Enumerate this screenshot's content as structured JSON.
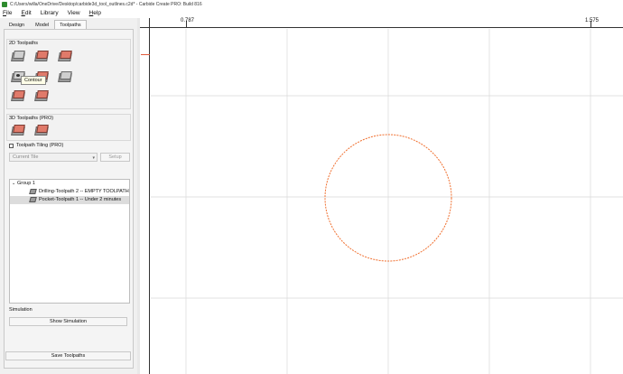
{
  "window": {
    "title": "C:/Users/willa/OneDrive/Desktop/carbide3d_tool_outlines.c2d* - Carbide Create PRO: Build 816"
  },
  "menu": [
    {
      "label": "File",
      "key": "F"
    },
    {
      "label": "Edit",
      "key": "E"
    },
    {
      "label": "Library",
      "key": ""
    },
    {
      "label": "View",
      "key": ""
    },
    {
      "label": "Help",
      "key": "H"
    }
  ],
  "tabs": [
    "Design",
    "Model",
    "Toolpaths"
  ],
  "toolpaths2d": {
    "title": "2D Toolpaths",
    "tooltip": "Contour"
  },
  "toolpaths3d": {
    "title": "3D Toolpaths (PRO)"
  },
  "tiling": {
    "label": "Toolpath Tiling (PRO)",
    "current_tile_placeholder": "Current Tile",
    "setup_label": "Setup"
  },
  "tree": {
    "group_label": "Group 1",
    "items": [
      {
        "label": "Drilling-Toolpath 2 -- EMPTY TOOLPATH",
        "selected": false
      },
      {
        "label": "Pocket-Toolpath 1 -- Under 2 minutes",
        "selected": true
      }
    ]
  },
  "simulation": {
    "title": "Simulation",
    "show_label": "Show Simulation"
  },
  "save_label": "Save Toolpaths",
  "ruler": {
    "top_labels": [
      "0.787",
      "1.575"
    ]
  },
  "colors": {
    "accent": "#e05a3a",
    "circle": "#f07030",
    "grid": "#d8d8d8"
  }
}
